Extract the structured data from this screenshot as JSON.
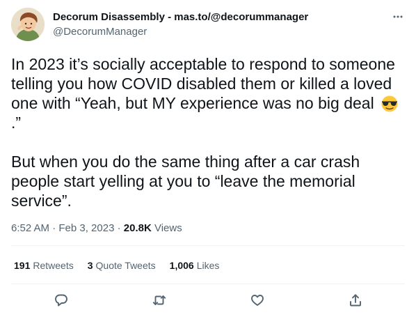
{
  "author": {
    "display_name": "Decorum Disassembly - mas.to/@decorummanager",
    "handle": "@DecorumManager"
  },
  "tweet": {
    "paragraph1": "In 2023 it’s socially acceptable to respond to someone telling you how COVID disabled them or killed a loved one with “Yeah, but MY experience was no big deal",
    "paragraph1_tail": ".”",
    "emoji": "smiling-face-with-sunglasses",
    "paragraph2": "But when you do the same thing after a car crash people start yelling at you to “leave the memorial service”."
  },
  "meta": {
    "time_date": "6:52 AM · Feb 3, 2023 · ",
    "views_count": "20.8K",
    "views_label": "Views"
  },
  "stats": {
    "retweets_count": "191",
    "retweets_label": "Retweets",
    "quotes_count": "3",
    "quotes_label": "Quote Tweets",
    "likes_count": "1,006",
    "likes_label": "Likes"
  },
  "colors": {
    "text_primary": "#0f1419",
    "text_secondary": "#536471",
    "divider": "#eff3f4",
    "emoji_yellow": "#fdc83a"
  },
  "icons": [
    "more-icon",
    "reply-icon",
    "retweet-icon",
    "like-icon",
    "share-icon"
  ]
}
